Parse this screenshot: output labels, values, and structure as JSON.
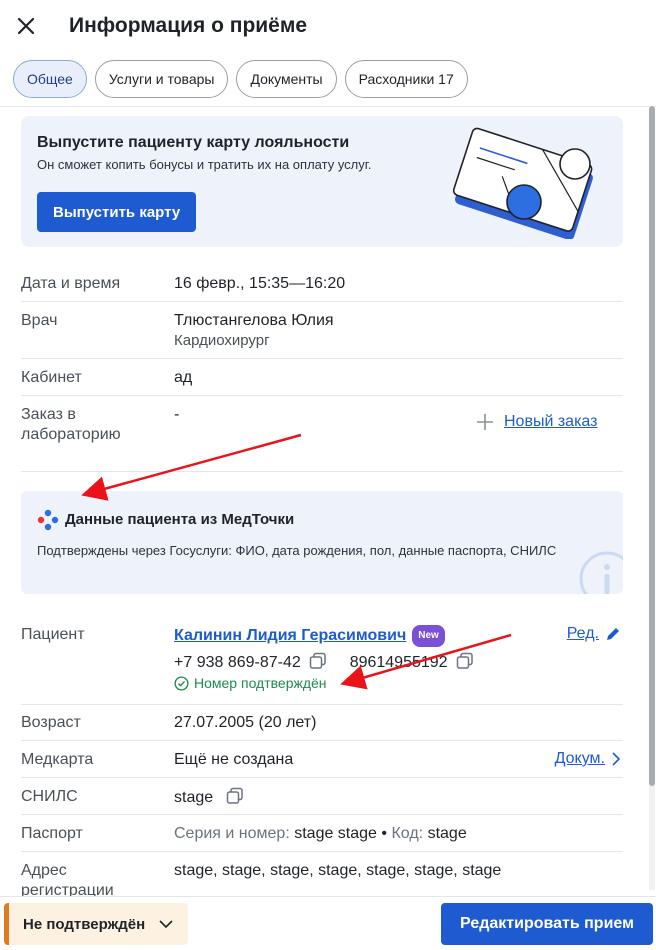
{
  "header": {
    "title": "Информация о приёме"
  },
  "tabs": [
    {
      "label": "Общее",
      "active": true
    },
    {
      "label": "Услуги и товары",
      "active": false
    },
    {
      "label": "Документы",
      "active": false
    },
    {
      "label": "Расходники 17",
      "active": false
    }
  ],
  "promo": {
    "title": "Выпустите пациенту карту лояльности",
    "text": "Он сможет копить бонусы и тратить их на оплату услуг.",
    "button": "Выпустить карту"
  },
  "details": {
    "datetime_label": "Дата и время",
    "datetime_value": "16 февр., 15:35—16:20",
    "doctor_label": "Врач",
    "doctor_name": "Тлюстангелова Юлия",
    "doctor_spec": "Кардиохирург",
    "cabinet_label": "Кабинет",
    "cabinet_value": "ад",
    "lab_label_1": "Заказ в",
    "lab_label_2": "лабораторию",
    "lab_value": "-",
    "new_order": "Новый заказ"
  },
  "medtochka": {
    "title": "Данные пациента из МедТочки",
    "text": "Подтверждены через Госуслуги: ФИО, дата рождения, пол, данные паспорта, СНИЛС"
  },
  "patient": {
    "label": "Пациент",
    "name": "Калинин Лидия Герасимович",
    "badge": "New",
    "edit_link": "Ред.",
    "phone1": "+7 938 869-87-42",
    "phone2": "89614955192",
    "verified": "Номер подтверждён",
    "age_label": "Возраст",
    "age_value": "27.07.2005 (20 лет)",
    "card_label": "Медкарта",
    "card_value": "Ещё не создана",
    "card_link": "Докум.",
    "snils_label": "СНИЛС",
    "snils_value": "stage",
    "passport_label": "Паспорт",
    "passport_series_label": "Серия и номер:",
    "passport_series_value": "stage stage",
    "passport_bullet": "•",
    "passport_code_label": "Код:",
    "passport_code_value": "stage",
    "address_label_1": "Адрес",
    "address_label_2": "регистрации",
    "address_value": "stage, stage, stage, stage, stage, stage, stage"
  },
  "footer": {
    "status": "Не подтверждён",
    "edit": "Редактировать прием"
  },
  "colors": {
    "accent": "#1e5bd1",
    "success": "#1e8a4c",
    "warning": "#e07a1f",
    "annotation": "#e8141a"
  }
}
